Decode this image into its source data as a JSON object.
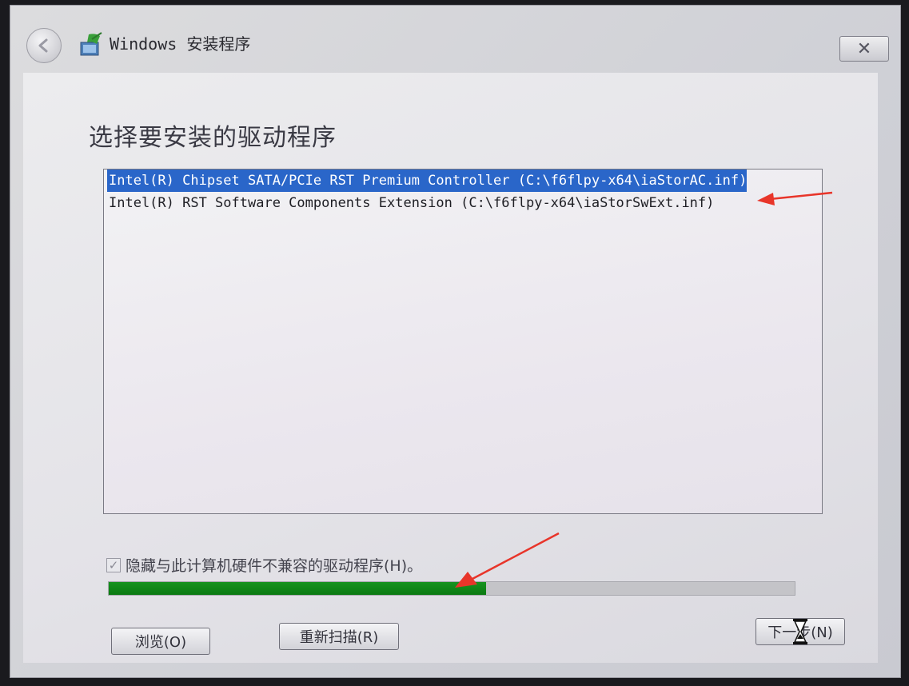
{
  "window": {
    "title": "Windows 安装程序",
    "close_label": "✕"
  },
  "page": {
    "title": "选择要安装的驱动程序"
  },
  "drivers": {
    "items": [
      {
        "label": "Intel(R) Chipset SATA/PCIe RST Premium Controller (C:\\f6flpy-x64\\iaStorAC.inf)",
        "selected": true
      },
      {
        "label": "Intel(R) RST Software Components Extension (C:\\f6flpy-x64\\iaStorSwExt.inf)",
        "selected": false
      }
    ]
  },
  "options": {
    "hide_incompatible_label": "隐藏与此计算机硬件不兼容的驱动程序(H)。",
    "hide_incompatible_checked": true
  },
  "progress": {
    "value_percent": 55
  },
  "buttons": {
    "browse_label": "浏览(O)",
    "rescan_label": "重新扫描(R)",
    "next_label": "下一步(N)"
  },
  "colors": {
    "selection": "#2a66c9",
    "progress": "#0b7a12",
    "annotation": "#e8352a"
  }
}
